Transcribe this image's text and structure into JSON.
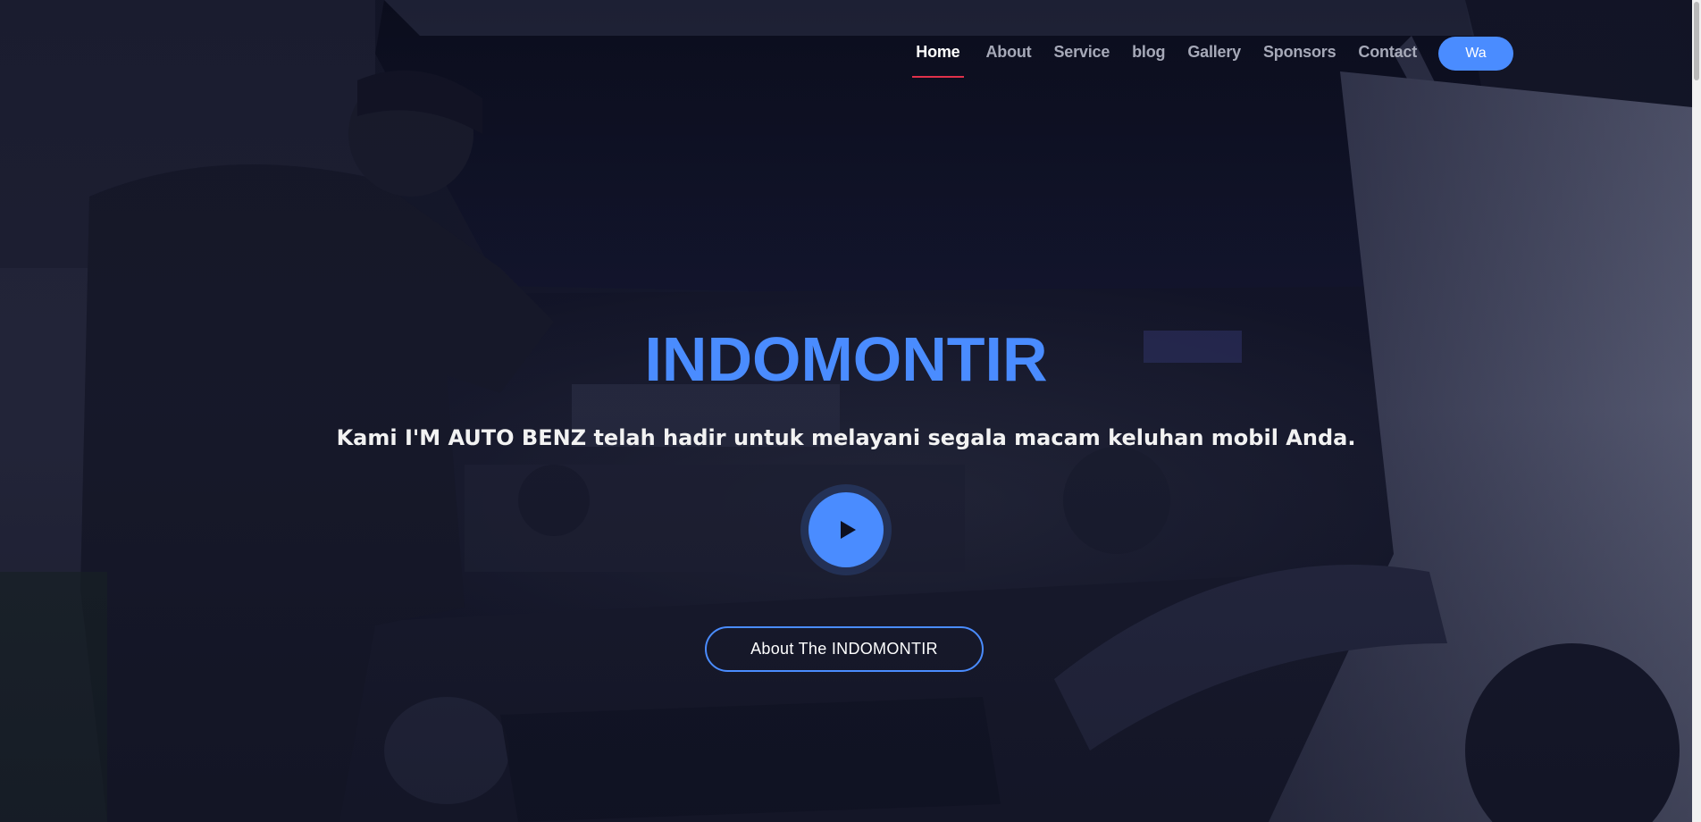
{
  "nav": {
    "items": [
      {
        "label": "Home",
        "active": true
      },
      {
        "label": "About",
        "active": false
      },
      {
        "label": "Service",
        "active": false
      },
      {
        "label": "blog",
        "active": false
      },
      {
        "label": "Gallery",
        "active": false
      },
      {
        "label": "Sponsors",
        "active": false
      },
      {
        "label": "Contact",
        "active": false
      }
    ],
    "cta_label": "Wa"
  },
  "hero": {
    "title": "INDOMONTIR",
    "subtitle": "Kami I'M AUTO BENZ telah hadir untuk melayani segala macam keluhan mobil Anda.",
    "play_icon": "play-icon",
    "about_button_label": "About The INDOMONTIR"
  },
  "colors": {
    "accent": "#4a8cff",
    "active_underline": "#e0314a",
    "nav_text": "#a6a9b8",
    "overlay": "#0f1120"
  }
}
